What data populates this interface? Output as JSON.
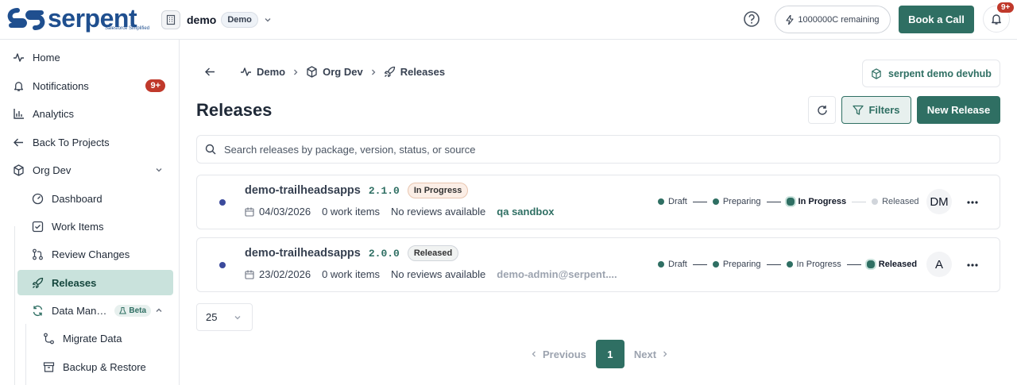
{
  "brand": {
    "name": "serpent",
    "tagline": "Salesforce Simplified",
    "color": "#1f4f8f"
  },
  "topbar": {
    "org_name": "demo",
    "org_badge": "Demo",
    "credits_label": "1000000C remaining",
    "book_call_label": "Book a Call",
    "notifications_badge": "9+"
  },
  "sidebar": {
    "home": "Home",
    "notifications": "Notifications",
    "notifications_badge": "9+",
    "analytics": "Analytics",
    "back": "Back To Projects",
    "org": "Org Dev",
    "dashboard": "Dashboard",
    "work_items": "Work Items",
    "review_changes": "Review Changes",
    "releases": "Releases",
    "data_management": "Data Man…",
    "beta": "Beta",
    "migrate": "Migrate Data",
    "backup": "Backup & Restore"
  },
  "breadcrumb": {
    "items": [
      "Demo",
      "Org Dev",
      "Releases"
    ]
  },
  "devhub_label": "serpent demo devhub",
  "page_title": "Releases",
  "actions": {
    "filters": "Filters",
    "new_release": "New Release"
  },
  "search": {
    "placeholder": "Search releases by package, version, status, or source"
  },
  "releases": [
    {
      "package": "demo-trailheadsapps",
      "version": "2.1.0",
      "status": "In Progress",
      "date": "04/03/2026",
      "work_items": "0 work items",
      "reviews": "No reviews available",
      "source": "qa sandbox",
      "stages": [
        "Draft",
        "Preparing",
        "In Progress",
        "Released"
      ],
      "current_stage": 2,
      "avatar": "DM"
    },
    {
      "package": "demo-trailheadsapps",
      "version": "2.0.0",
      "status": "Released",
      "date": "23/02/2026",
      "work_items": "0 work items",
      "reviews": "No reviews available",
      "source": "demo-admin@serpent....",
      "stages": [
        "Draft",
        "Preparing",
        "In Progress",
        "Released"
      ],
      "current_stage": 3,
      "avatar": "A"
    }
  ],
  "pagination": {
    "per_page": "25",
    "previous": "Previous",
    "current": "1",
    "next": "Next"
  },
  "colors": {
    "primary": "#2f6f63",
    "active_bg": "#c9e2dc",
    "badge_red": "#c0392b"
  }
}
